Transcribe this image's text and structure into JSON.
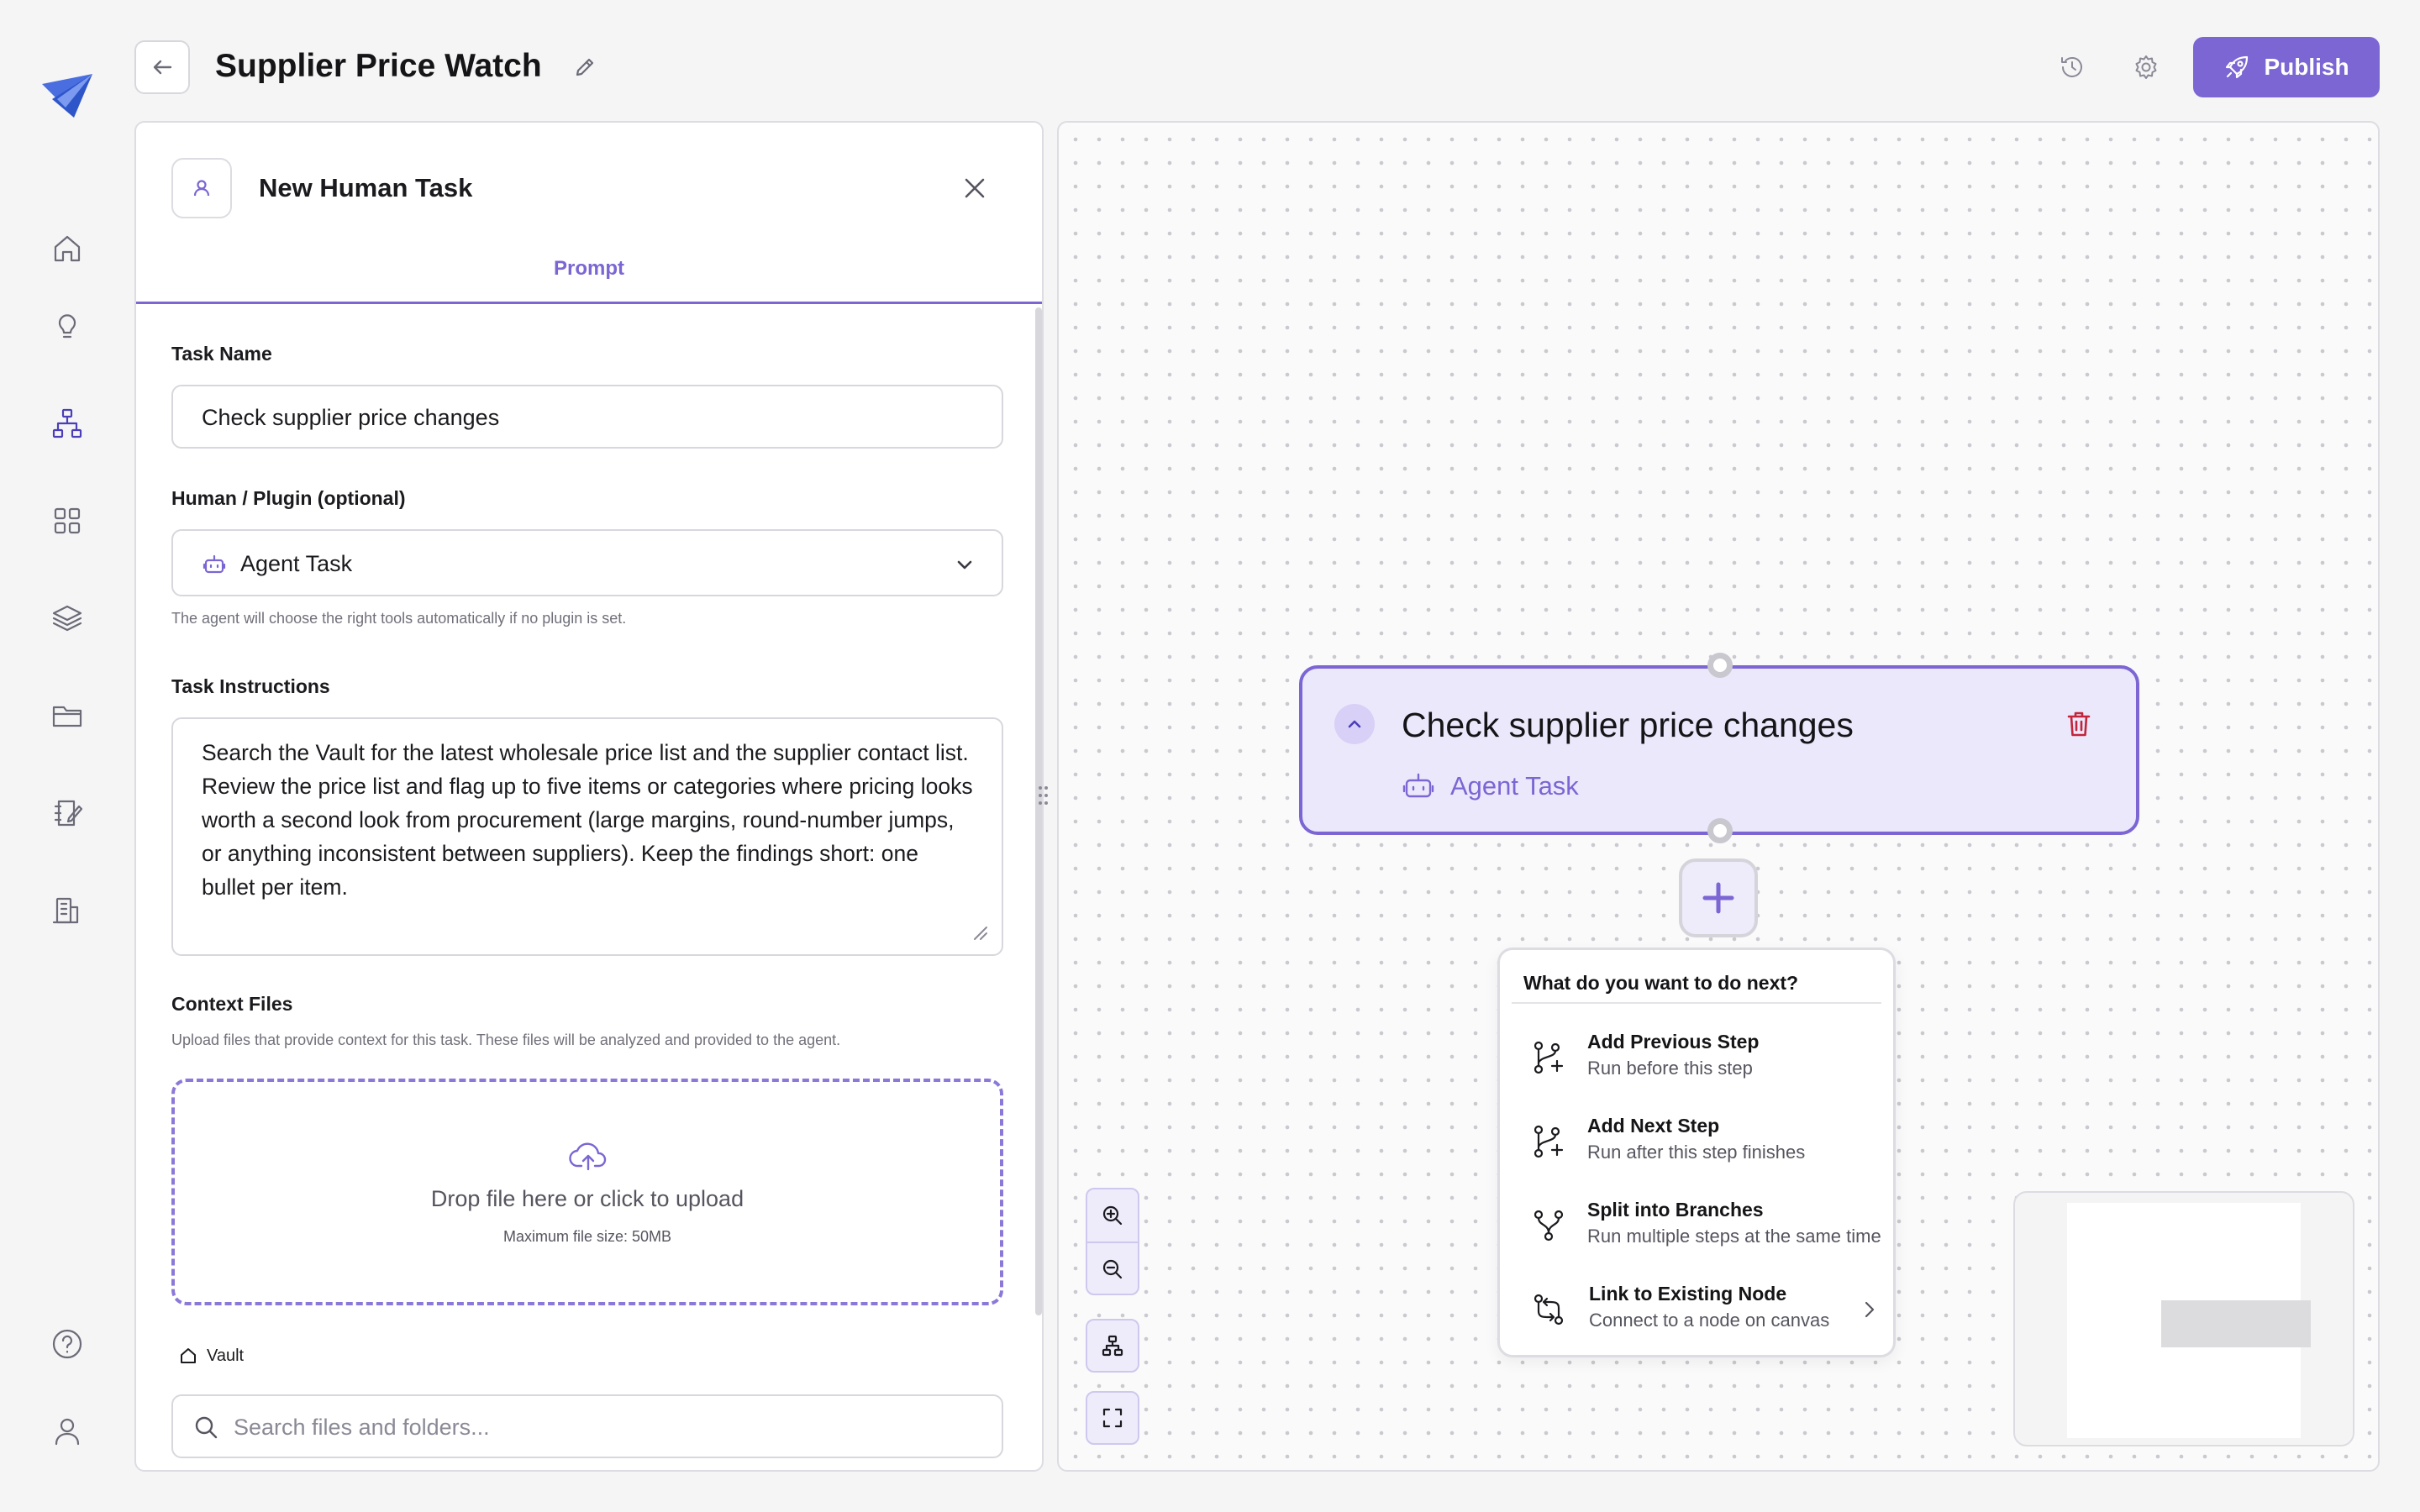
{
  "app": {
    "title": "Supplier Price Watch",
    "accent_color": "#7b66d3",
    "publish_label": "Publish"
  },
  "header": {
    "icons": [
      "back-arrow-icon",
      "pencil-icon",
      "history-icon",
      "gear-icon",
      "rocket-icon"
    ]
  },
  "sidebar": {
    "items": [
      {
        "id": "home",
        "icon": "home-icon"
      },
      {
        "id": "ideas",
        "icon": "lightbulb-icon"
      },
      {
        "id": "workflows",
        "icon": "org-chart-icon",
        "active": true
      },
      {
        "id": "apps",
        "icon": "grid-icon"
      },
      {
        "id": "layers",
        "icon": "layers-icon"
      },
      {
        "id": "files",
        "icon": "folder-icon"
      },
      {
        "id": "notes",
        "icon": "notebook-edit-icon"
      },
      {
        "id": "organization",
        "icon": "building-icon"
      },
      {
        "id": "help",
        "icon": "help-icon"
      },
      {
        "id": "profile",
        "icon": "user-icon"
      }
    ]
  },
  "panel": {
    "title": "New Human Task",
    "tab": "Prompt",
    "task_name_label": "Task Name",
    "task_name_value": "Check supplier price changes",
    "plugin_label": "Human / Plugin (optional)",
    "plugin_value": "Agent Task",
    "plugin_hint": "The agent will choose the right tools automatically if no plugin is set.",
    "instructions_label": "Task Instructions",
    "instructions_value": "Search the Vault for the latest wholesale price list and the supplier contact list. Review the price list and flag up to five items or categories where pricing looks worth a second look from procurement (large margins, round-number jumps, or anything inconsistent between suppliers). Keep the findings short: one bullet per item.",
    "context_label": "Context Files",
    "context_hint": "Upload files that provide context for this task. These files will be analyzed and provided to the agent.",
    "dropzone_title": "Drop file here or click to upload",
    "dropzone_sub": "Maximum file size: 50MB",
    "vault_label": "Vault",
    "search_placeholder": "Search files and folders..."
  },
  "canvas": {
    "node": {
      "title": "Check supplier price changes",
      "subtype": "Agent Task"
    },
    "menu": {
      "heading": "What do you want to do next?",
      "items": [
        {
          "title": "Add Previous Step",
          "subtitle": "Run before this step",
          "icon": "branch-add-previous-icon"
        },
        {
          "title": "Add Next Step",
          "subtitle": "Run after this step finishes",
          "icon": "branch-add-next-icon"
        },
        {
          "title": "Split into Branches",
          "subtitle": "Run multiple steps at the same time",
          "icon": "split-branches-icon"
        },
        {
          "title": "Link to Existing Node",
          "subtitle": "Connect to a node on canvas",
          "icon": "link-node-icon"
        }
      ]
    }
  }
}
